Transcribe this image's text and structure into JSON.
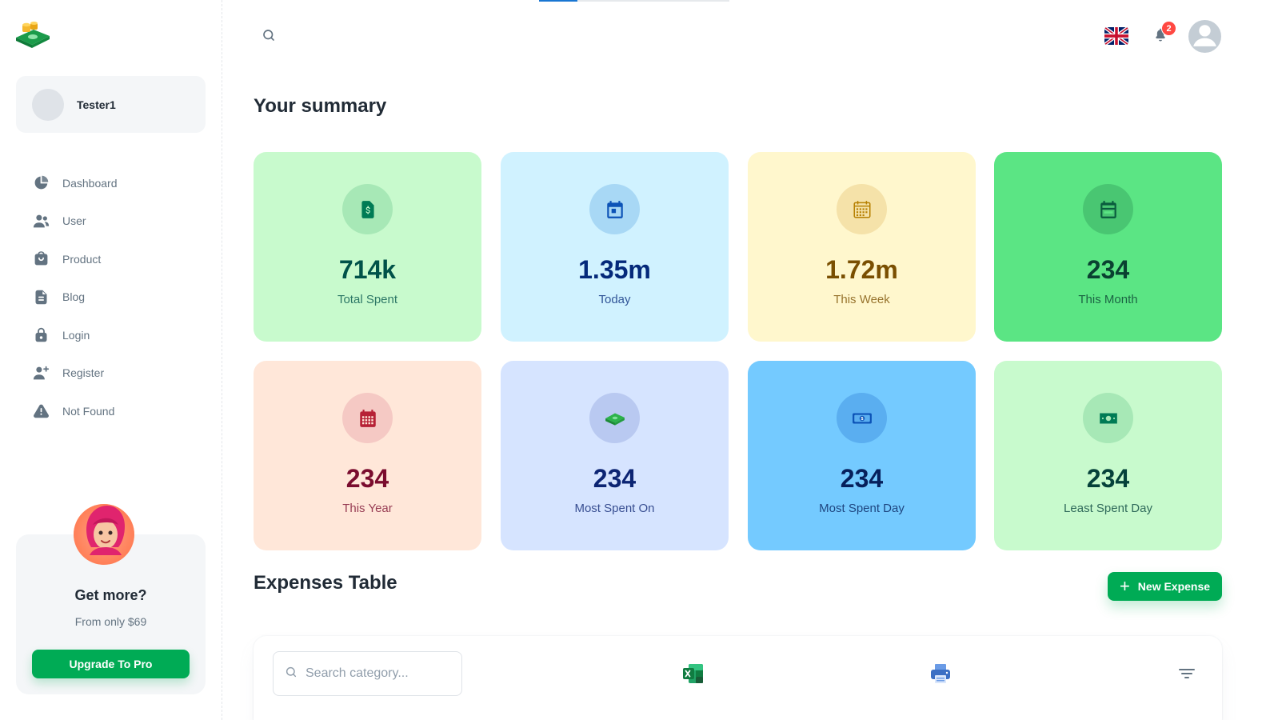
{
  "sidebar": {
    "account_name": "Tester1",
    "nav": [
      {
        "label": "Dashboard",
        "icon": "pie-chart-icon"
      },
      {
        "label": "User",
        "icon": "people-icon"
      },
      {
        "label": "Product",
        "icon": "shopping-bag-icon"
      },
      {
        "label": "Blog",
        "icon": "file-text-icon"
      },
      {
        "label": "Login",
        "icon": "lock-icon"
      },
      {
        "label": "Register",
        "icon": "person-add-icon"
      },
      {
        "label": "Not Found",
        "icon": "alert-triangle-icon"
      }
    ],
    "promo": {
      "title": "Get more?",
      "subtitle": "From only $69",
      "button": "Upgrade To Pro"
    }
  },
  "header": {
    "notifications_count": "2",
    "language_flag": "uk-flag-icon"
  },
  "summary": {
    "title": "Your summary",
    "cards": [
      {
        "value": "714k",
        "label": "Total Spent",
        "icon": "money-document-icon",
        "bg": "#c8facd",
        "circle": "#a7e8b6",
        "color": "#005249",
        "iconColor": "#007b55"
      },
      {
        "value": "1.35m",
        "label": "Today",
        "icon": "calendar-day-icon",
        "bg": "#d0f2ff",
        "circle": "#a8d8f5",
        "color": "#04297a",
        "iconColor": "#0c53b7"
      },
      {
        "value": "1.72m",
        "label": "This Week",
        "icon": "calendar-week-icon",
        "bg": "#fff7cd",
        "circle": "#f5e2a9",
        "color": "#7a4f01",
        "iconColor": "#b78103"
      },
      {
        "value": "234",
        "label": "This Month",
        "icon": "calendar-month-icon",
        "bg": "#5be584",
        "circle": "#49c672",
        "color": "#0a4131",
        "iconColor": "#0a5c3e"
      },
      {
        "value": "234",
        "label": "This Year",
        "icon": "calendar-year-icon",
        "bg": "#ffe7d9",
        "circle": "#f5c9c4",
        "color": "#7a0c2e",
        "iconColor": "#b72136"
      },
      {
        "value": "234",
        "label": "Most Spent On",
        "icon": "cash-stack-icon",
        "bg": "#d6e4ff",
        "circle": "#b9c9f1",
        "color": "#0c2473",
        "iconColor": "#229a16"
      },
      {
        "value": "234",
        "label": "Most Spent Day",
        "icon": "banknote-icon",
        "bg": "#74caff",
        "circle": "#5aaef0",
        "color": "#06205c",
        "iconColor": "#0c53b7"
      },
      {
        "value": "234",
        "label": "Least Spent Day",
        "icon": "cash-icon",
        "bg": "#c8facd",
        "circle": "#a7e8b6",
        "color": "#05413a",
        "iconColor": "#007b55"
      }
    ]
  },
  "expenses": {
    "title": "Expenses Table",
    "new_button": "New Expense",
    "search_placeholder": "Search category..."
  }
}
